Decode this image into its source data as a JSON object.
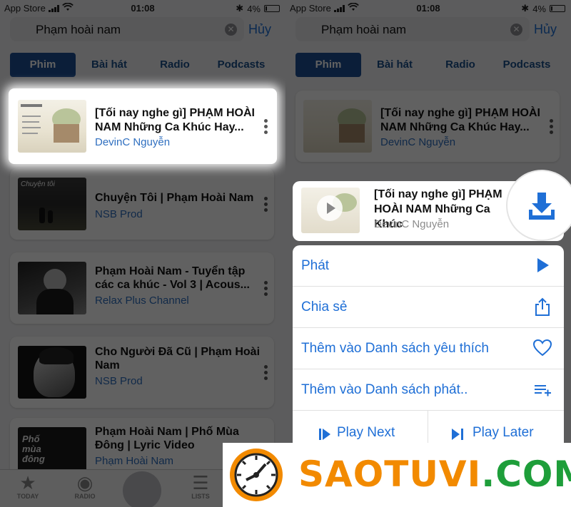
{
  "status_bar": {
    "carrier": "App Store",
    "time": "01:08",
    "battery": "4%"
  },
  "search": {
    "query": "Phạm hoài nam",
    "cancel_label": "Hủy"
  },
  "tabs": [
    "Phim",
    "Bài hát",
    "Radio",
    "Podcasts"
  ],
  "active_tab": "Phim",
  "results": [
    {
      "title": "[Tối nay nghe gì] PHẠM HOÀI NAM   Những Ca Khúc Hay...",
      "channel": "DevinC Nguyễn"
    },
    {
      "title": "Chuyện Tôi | Phạm Hoài Nam",
      "channel": "NSB Prod"
    },
    {
      "title": "Phạm Hoài Nam - Tuyển tập các ca khúc  - Vol 3 | Acous...",
      "channel": "Relax Plus Channel"
    },
    {
      "title": "Cho Người Đã Cũ | Phạm Hoài Nam",
      "channel": "NSB Prod"
    },
    {
      "title": "Phạm Hoài Nam | Phố Mùa Đông | Lyric Video",
      "channel": "Phạm Hoài Nam"
    }
  ],
  "thumb_labels": {
    "r2": "Chuyện tôi",
    "r5": "Phố mùa đông"
  },
  "bottom_tabbar": {
    "today": "TODAY",
    "radio": "RADIO",
    "lists": "LISTS"
  },
  "selected_item": {
    "title": "[Tối nay nghe gì] PHẠM HOÀI NAM   Những Ca Khúc",
    "channel": "DevinC Nguyễn"
  },
  "actions": [
    {
      "label": "Phát",
      "icon": "play-icon"
    },
    {
      "label": "Chia sẻ",
      "icon": "share-icon"
    },
    {
      "label": "Thêm vào Danh sách yêu thích",
      "icon": "heart-icon"
    },
    {
      "label": "Thêm vào Danh sách phát..",
      "icon": "playlist-add-icon"
    }
  ],
  "queue_actions": {
    "play_next": "Play Next",
    "play_later": "Play Later"
  },
  "watermark": {
    "text": "SAOTUVI.COM",
    "part1": "SAOTUVI",
    "part2": ".",
    "part3": "COM",
    "orange": "#f28a00",
    "green": "#1e9e3a"
  },
  "colors": {
    "accent": "#1f6fd6",
    "tab_active": "#1d4f95"
  }
}
